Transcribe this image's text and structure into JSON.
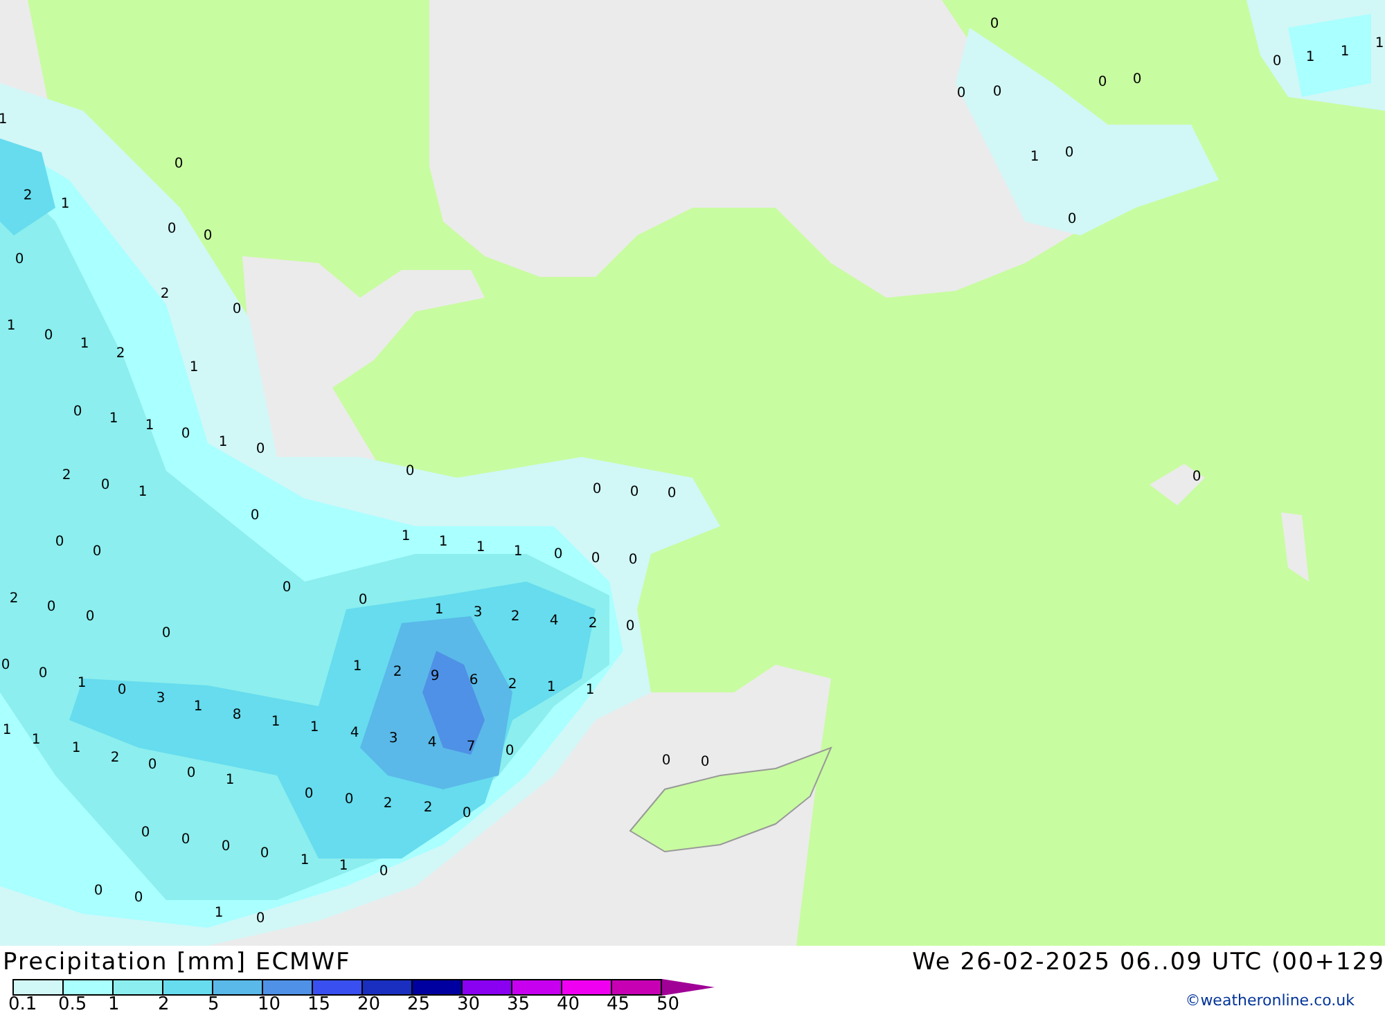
{
  "map": {
    "values": [
      "0",
      "0",
      "1",
      "1",
      "1",
      "0",
      "0",
      "0",
      "0",
      "1",
      "0",
      "0",
      "1",
      "0",
      "2",
      "1",
      "0",
      "0",
      "0",
      "2",
      "0",
      "1",
      "0",
      "1",
      "2",
      "1",
      "0",
      "1",
      "1",
      "0",
      "1",
      "0",
      "2",
      "0",
      "1",
      "0",
      "0",
      "0",
      "0",
      "0",
      "0",
      "0",
      "0",
      "1",
      "1",
      "1",
      "1",
      "0",
      "0",
      "0",
      "2",
      "0",
      "0",
      "0",
      "0",
      "0",
      "1",
      "3",
      "2",
      "4",
      "2",
      "0",
      "0",
      "0",
      "1",
      "0",
      "1",
      "2",
      "9",
      "6",
      "2",
      "1",
      "1",
      "3",
      "1",
      "8",
      "1",
      "1",
      "4",
      "3",
      "4",
      "7",
      "0",
      "1",
      "1",
      "1",
      "2",
      "0",
      "0",
      "1",
      "0",
      "0",
      "0",
      "0",
      "2",
      "2",
      "0",
      "0",
      "0",
      "0",
      "0",
      "1",
      "1",
      "0",
      "0",
      "0",
      "1",
      "0"
    ]
  },
  "footer": {
    "title": "Precipitation [mm] ECMWF",
    "valid_time": "We 26-02-2025 06..09 UTC (00+129",
    "credit": "©weatheronline.co.uk"
  },
  "legend": {
    "ticks": [
      "0.1",
      "0.5",
      "1",
      "2",
      "5",
      "10",
      "15",
      "20",
      "25",
      "30",
      "35",
      "40",
      "45",
      "50"
    ],
    "bins": [
      {
        "color": "#d2f7f7"
      },
      {
        "color": "#aaffff"
      },
      {
        "color": "#8ceeee"
      },
      {
        "color": "#66dcee"
      },
      {
        "color": "#5ab9e8"
      },
      {
        "color": "#4f91e6"
      },
      {
        "color": "#3a4fef"
      },
      {
        "color": "#1a2fc0"
      },
      {
        "color": "#0000a0"
      },
      {
        "color": "#8a00f0"
      },
      {
        "color": "#c800f0"
      },
      {
        "color": "#f000f0"
      },
      {
        "color": "#c800b4"
      }
    ]
  }
}
